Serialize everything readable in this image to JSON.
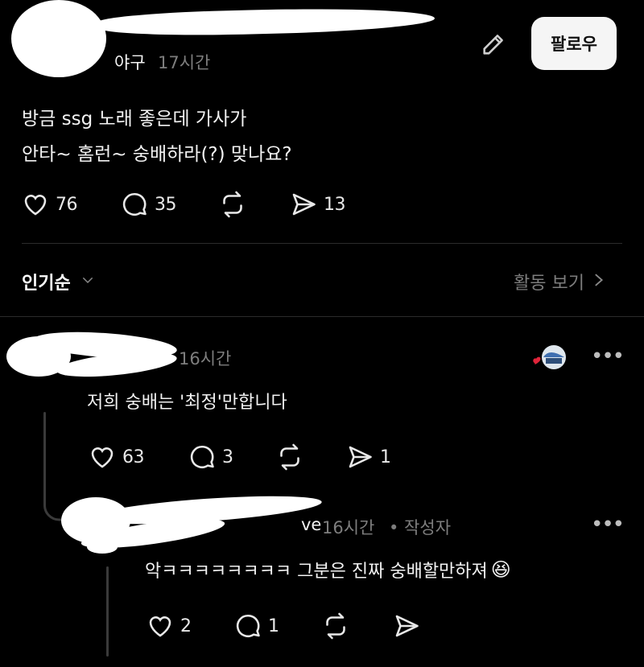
{
  "post": {
    "category": "야구",
    "time": "17시간",
    "follow_label": "팔로우",
    "text_line1": "방금 ssg 노래 좋은데 가사가",
    "text_line2": "안타~ 홈런~ 숭배하라(?) 맞나요?",
    "likes": "76",
    "comments": "35",
    "shares": "13"
  },
  "sort": {
    "label": "인기순",
    "activity_label": "활동 보기"
  },
  "comments": [
    {
      "time": "16시간",
      "text": "저희 숭배는 '최정'만합니다",
      "likes": "63",
      "comments": "3",
      "shares": "1"
    },
    {
      "name_suffix": "ve",
      "time": "16시간",
      "author_tag": "• 작성자",
      "text": "악ㅋㅋㅋㅋㅋㅋㅋㅋ 그분은 진짜 숭배할만하져",
      "emoji": "😆",
      "likes": "2",
      "comments": "1"
    }
  ],
  "icons": {
    "heart": "heart-icon",
    "comment": "comment-icon",
    "repost": "repost-icon",
    "share": "send-icon",
    "edit": "pencil-icon",
    "more": "more-icon",
    "chevron": "chevron-icon"
  }
}
